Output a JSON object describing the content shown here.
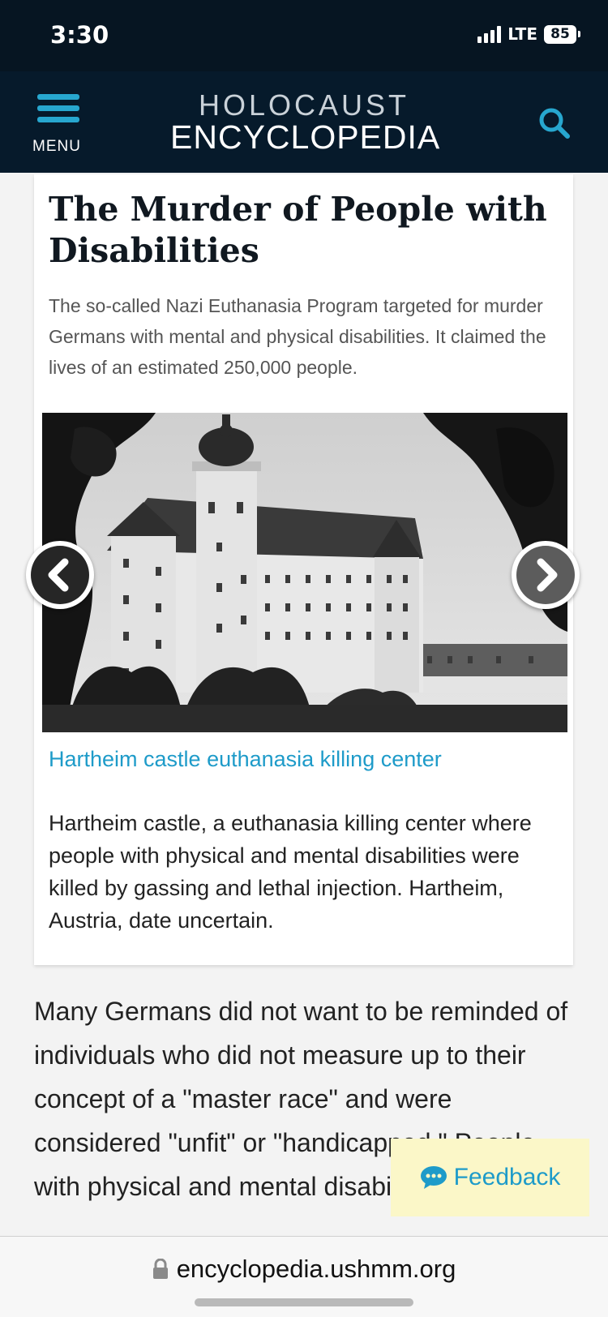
{
  "status_bar": {
    "time": "3:30",
    "network": "LTE",
    "battery": "85"
  },
  "header": {
    "menu_label": "MENU",
    "logo_top": "HOLOCAUST",
    "logo_bottom": "ENCYCLOPEDIA",
    "accent_color": "#27a7cf",
    "background_color": "#061a2b"
  },
  "article": {
    "title": "The Murder of People with Disabilities",
    "summary": "The so-called Nazi Euthanasia Program targeted for murder Germans with mental and physical disabilities. It claimed the lives of an estimated 250,000 people."
  },
  "carousel": {
    "prev_icon": "chevron-left-icon",
    "next_icon": "chevron-right-icon",
    "caption_title": "Hartheim castle euthanasia killing center",
    "caption_text": "Hartheim castle, a euthanasia killing center where people with physical and mental disabilities were killed by gassing and lethal injection. Hartheim, Austria, date uncertain."
  },
  "body": {
    "paragraph": "Many Germans did not want to be reminded of individuals who did not measure up to their concept of a \"master race\" and were considered \"unfit\" or \"handicapped.\" People with physical and mental disabilities were"
  },
  "feedback": {
    "label": "Feedback",
    "icon": "speech-bubble-icon",
    "background_color": "#fbf7c8"
  },
  "browser": {
    "url": "encyclopedia.ushmm.org",
    "lock_icon": "lock-icon"
  }
}
